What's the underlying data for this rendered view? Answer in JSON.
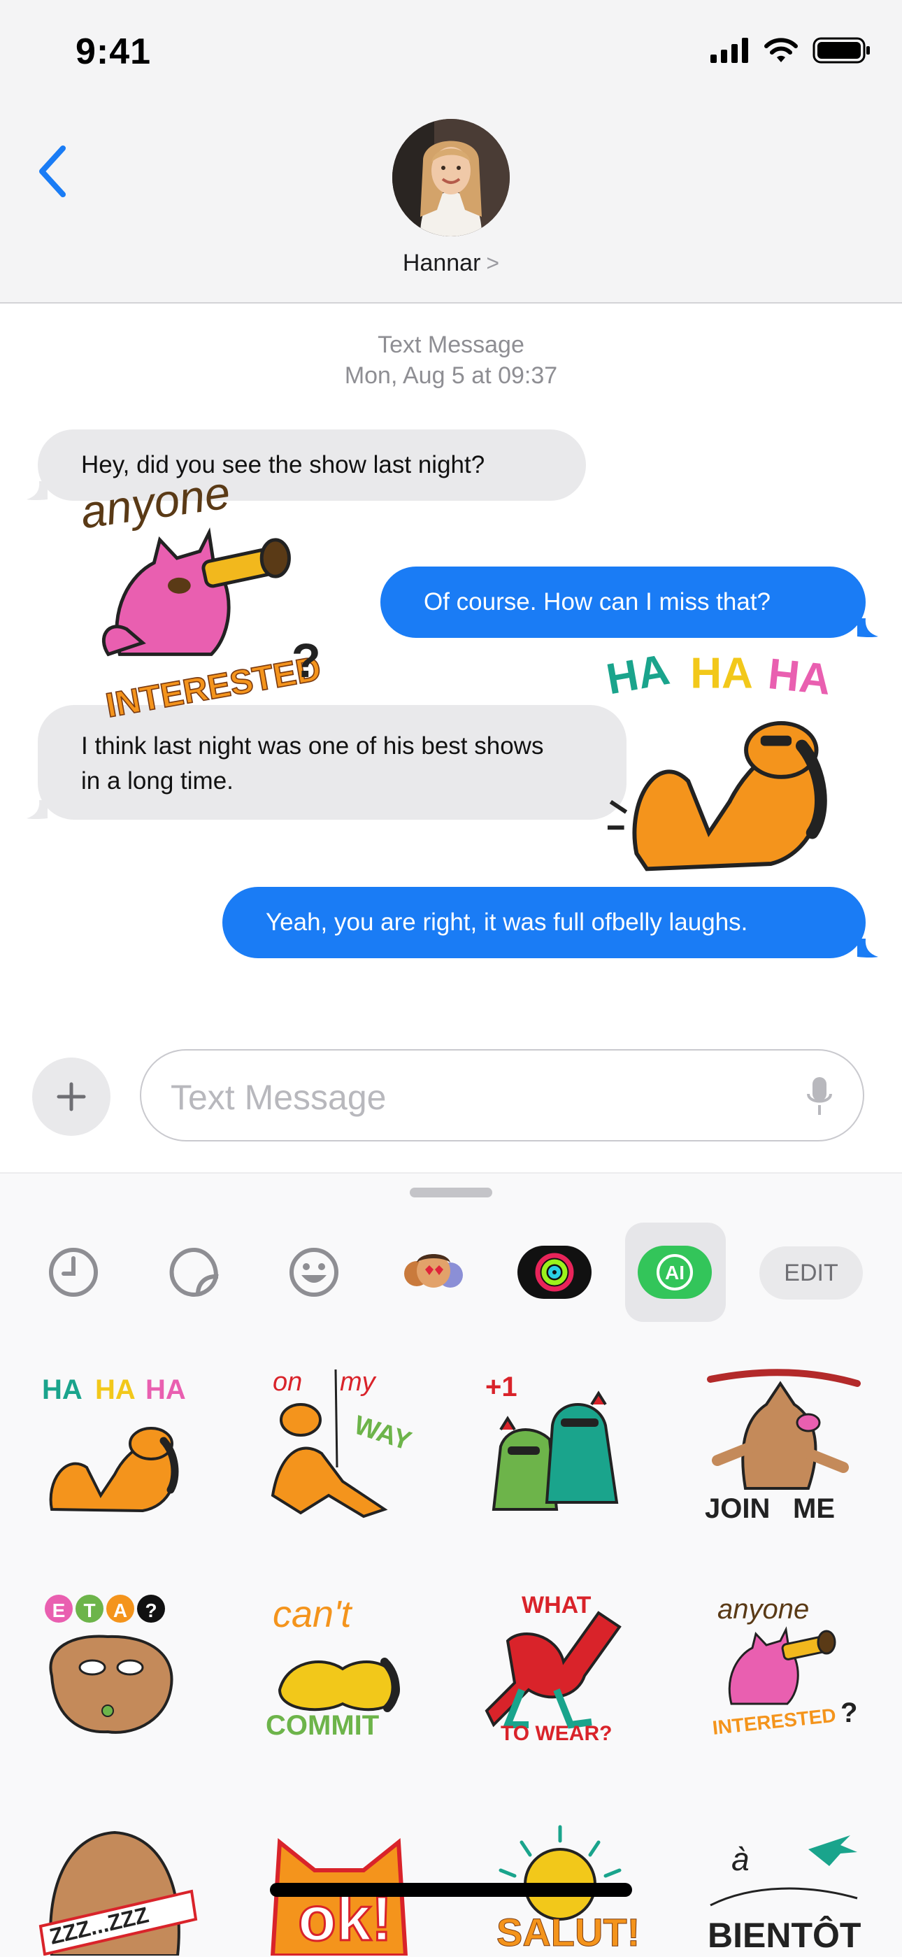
{
  "status_bar": {
    "time": "9:41"
  },
  "header": {
    "contact_name": "Hannar",
    "chevron": ">"
  },
  "conversation": {
    "meta_label": "Text Message",
    "meta_date": "Mon, Aug 5 at 09:37",
    "messages": [
      {
        "side": "incoming",
        "text": "Hey, did you see the show last night?"
      },
      {
        "side": "outgoing",
        "text": "Of course. How can I miss that?"
      },
      {
        "side": "incoming",
        "text_line1": "I think last night was one of his best shows",
        "text_line2": "in a long time."
      },
      {
        "side": "outgoing",
        "text": "Yeah, you are right, it was full ofbelly laughs."
      }
    ],
    "stickers": [
      {
        "name": "anyone-interested",
        "words": [
          "anyone",
          "INTERESTED",
          "?"
        ]
      },
      {
        "name": "ha-ha-ha",
        "words": [
          "HA",
          "HA",
          "HA"
        ]
      }
    ]
  },
  "input_bar": {
    "placeholder": "Text Message"
  },
  "drawer": {
    "tabs": [
      "recents-icon",
      "stickers-icon",
      "emoji-icon",
      "memoji-icon",
      "activity-icon",
      "ai-sticker-icon"
    ],
    "ai_label": "AI",
    "edit_label": "EDIT",
    "stickers": [
      {
        "name": "ha-ha-ha",
        "words": [
          "HA",
          "HA",
          "HA"
        ]
      },
      {
        "name": "on-my-way",
        "words": [
          "on",
          "my",
          "WAY"
        ]
      },
      {
        "name": "plus-one",
        "words": [
          "+1"
        ]
      },
      {
        "name": "join-me",
        "words": [
          "JOIN",
          "ME"
        ]
      },
      {
        "name": "eta",
        "words": [
          "E",
          "T",
          "A",
          "?"
        ]
      },
      {
        "name": "cant-commit",
        "words": [
          "can't",
          "COMMIT"
        ]
      },
      {
        "name": "what-to-wear",
        "words": [
          "WHAT",
          "TO WEAR?"
        ]
      },
      {
        "name": "anyone-interested",
        "words": [
          "anyone",
          "INTERESTED",
          "?"
        ]
      },
      {
        "name": "zzz",
        "words": [
          "ZZZ...ZZZ"
        ]
      },
      {
        "name": "ok",
        "words": [
          "ok!"
        ]
      },
      {
        "name": "salut",
        "words": [
          "SALUT!"
        ]
      },
      {
        "name": "a-bientot",
        "words": [
          "à",
          "BIENTÔT"
        ]
      }
    ]
  },
  "colors": {
    "accent": "#1a7cf5",
    "incoming_bubble": "#e9e9eb",
    "sticker_orange": "#f4941c",
    "sticker_pink": "#e95fb0"
  }
}
